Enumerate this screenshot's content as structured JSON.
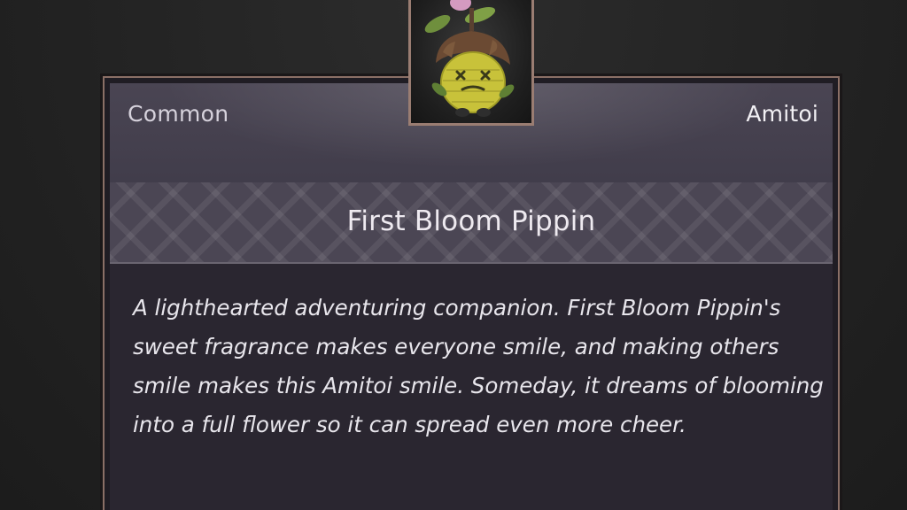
{
  "item": {
    "rarity": "Common",
    "category": "Amitoi",
    "name": "First Bloom Pippin",
    "description": "A lighthearted adventuring companion. First Bloom Pippin's sweet fragrance makes everyone smile, and making others smile makes this Amitoi smile. Someday, it dreams of blooming into a full flower so it can spread even more cheer.",
    "portrait_icon": "amitoi-pippin-icon"
  },
  "colors": {
    "frame_border": "#8a6f66",
    "portrait_border": "#9a7d72",
    "panel_top": "#4a4553",
    "description_bg": "#2a2630",
    "text_primary": "#eeeaf0"
  }
}
